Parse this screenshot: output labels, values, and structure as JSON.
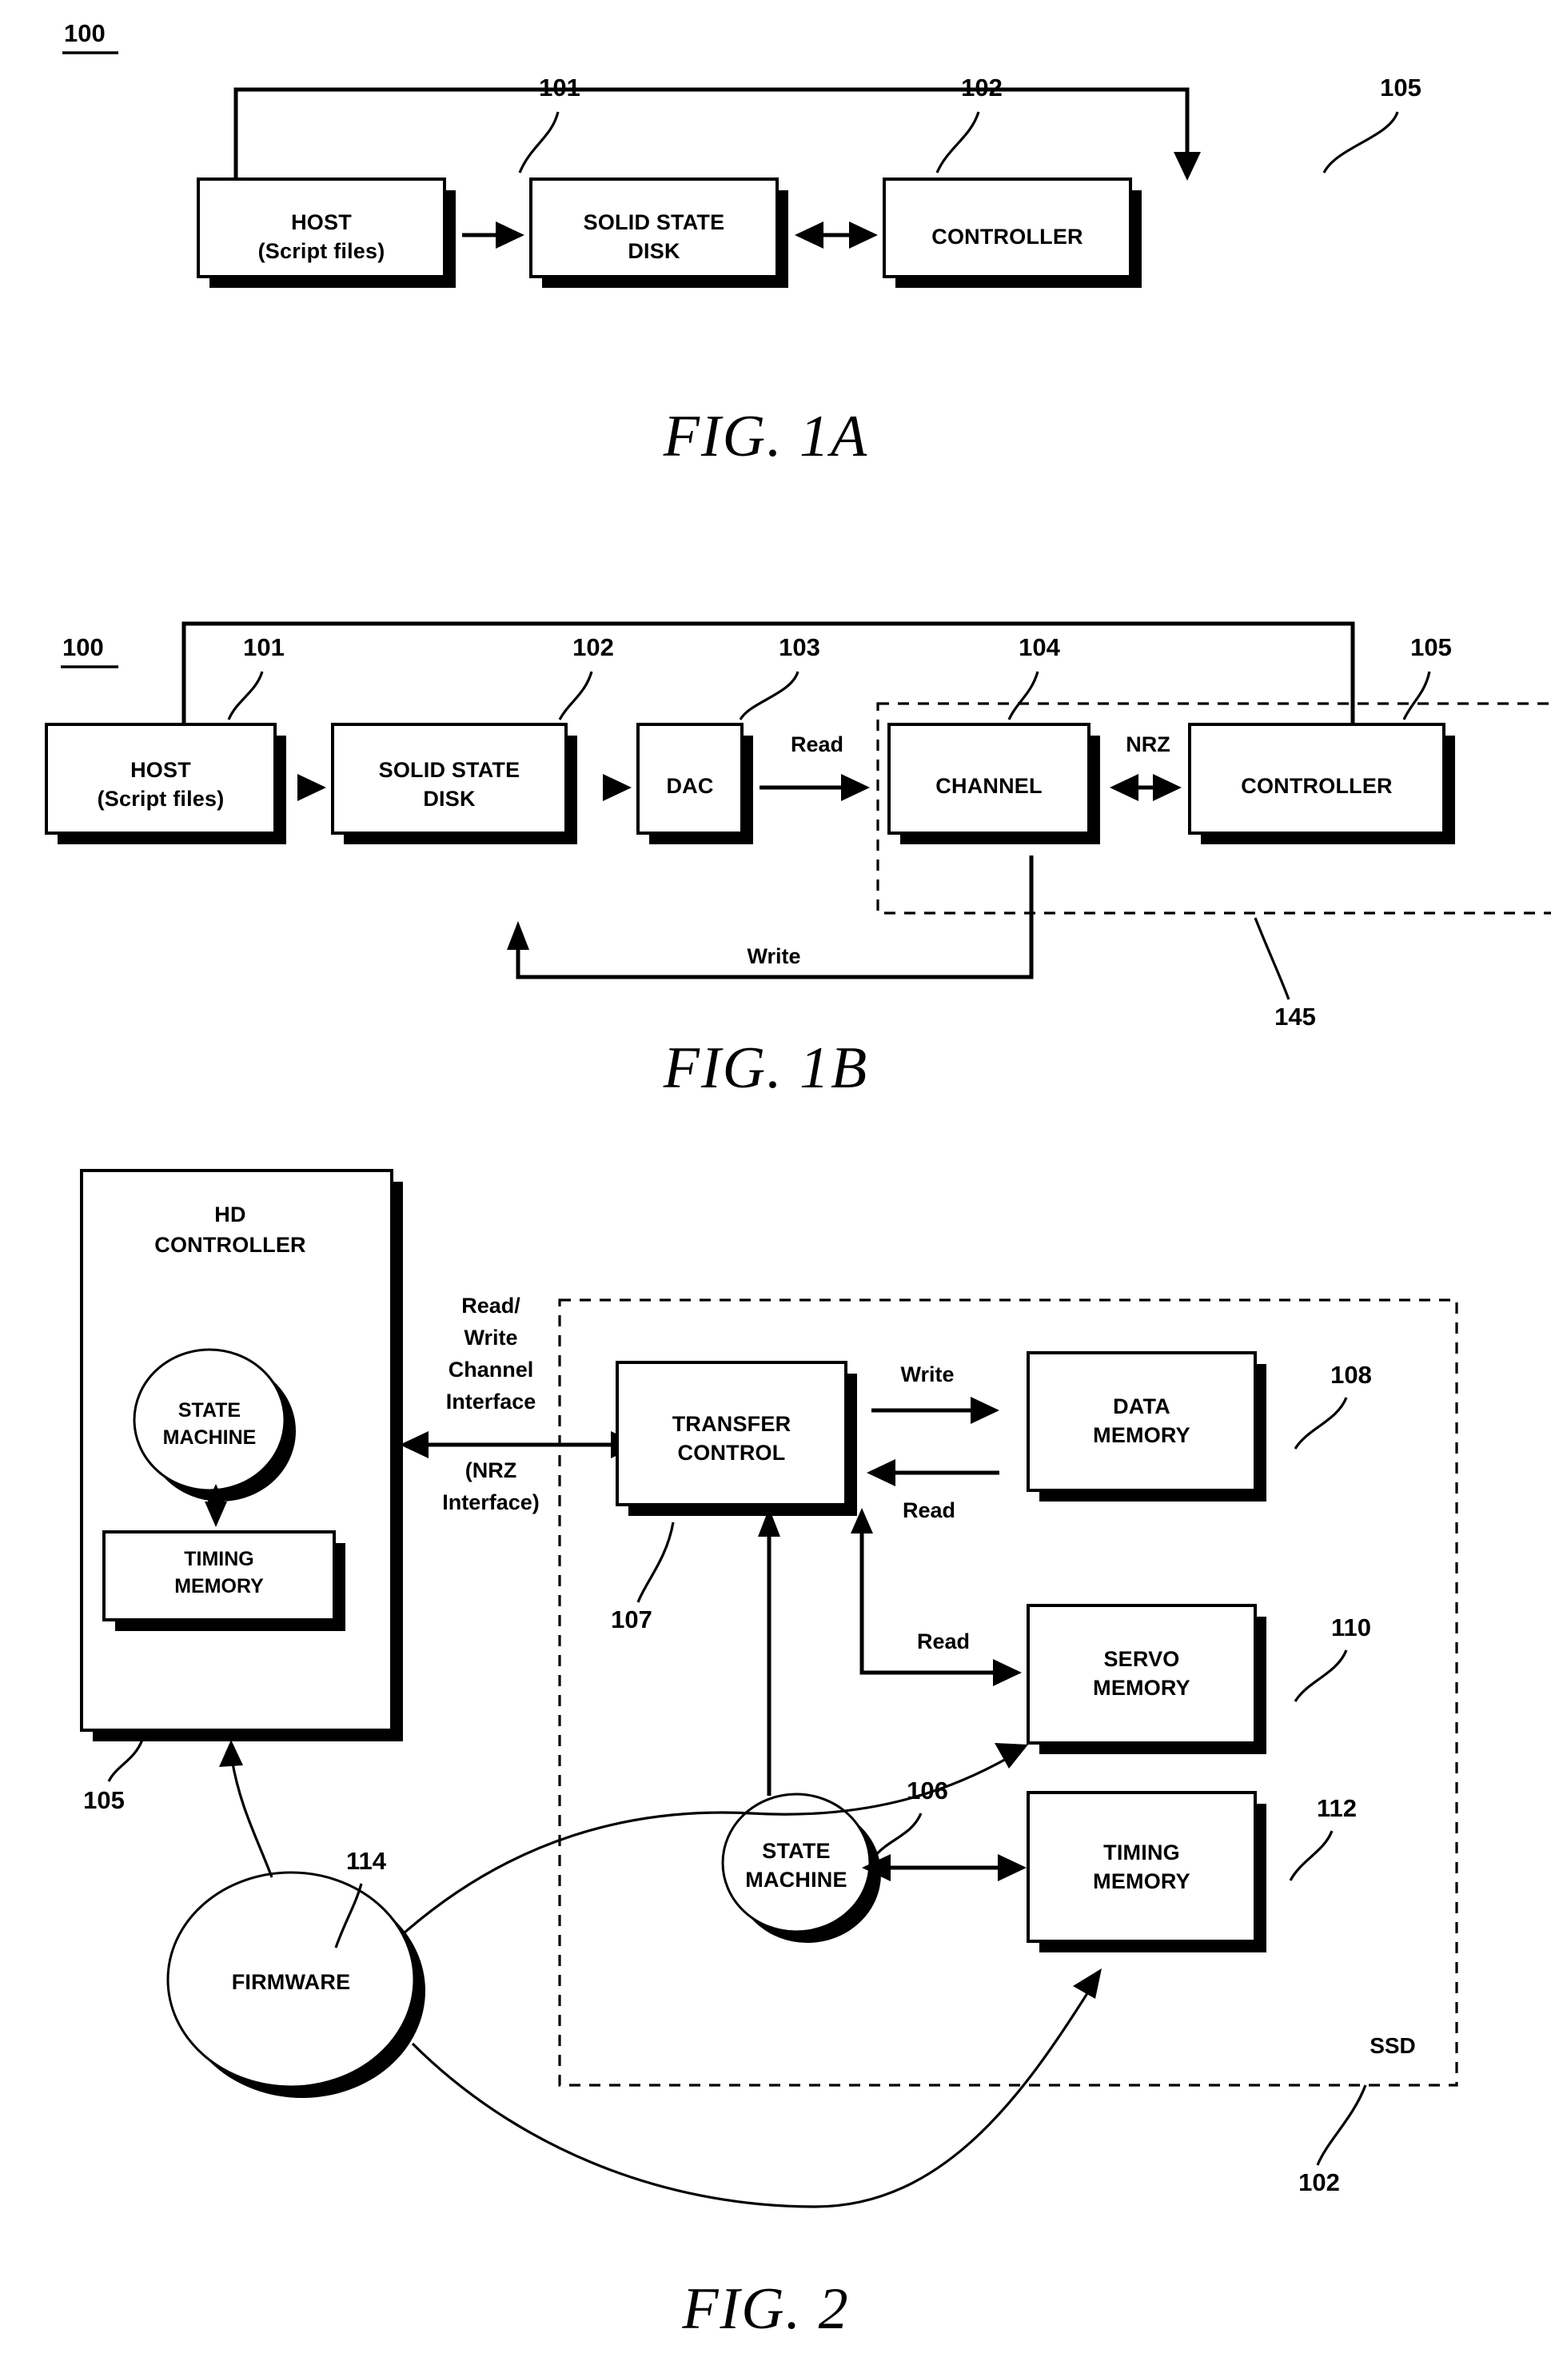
{
  "document": {
    "type": "patent-figure-sheet",
    "figures": [
      "FIG. 1A",
      "FIG. 1B",
      "FIG. 2"
    ]
  },
  "fig1a": {
    "title": "FIG. 1A",
    "system_ref": "100",
    "boxes": [
      {
        "id": "host",
        "line1": "HOST",
        "line2": "(Script files)",
        "ref": "101"
      },
      {
        "id": "ssd",
        "line1": "SOLID STATE",
        "line2": "DISK",
        "ref": "102"
      },
      {
        "id": "controller",
        "line1": "CONTROLLER",
        "line2": "",
        "ref": "105"
      }
    ]
  },
  "fig1b": {
    "title": "FIG. 1B",
    "system_ref": "100",
    "boxes": [
      {
        "id": "host",
        "line1": "HOST",
        "line2": "(Script files)",
        "ref": "101"
      },
      {
        "id": "ssd",
        "line1": "SOLID STATE",
        "line2": "DISK",
        "ref": "102"
      },
      {
        "id": "dac",
        "line1": "DAC",
        "line2": "",
        "ref": "103"
      },
      {
        "id": "channel",
        "line1": "CHANNEL",
        "line2": "",
        "ref": "104"
      },
      {
        "id": "controller",
        "line1": "CONTROLLER",
        "line2": "",
        "ref": "105"
      }
    ],
    "edge_labels": {
      "read": "Read",
      "nrz": "NRZ",
      "write": "Write"
    },
    "group_ref": "145"
  },
  "fig2": {
    "title": "FIG. 2",
    "hd_controller": {
      "line1": "HD",
      "line2": "CONTROLLER",
      "ref": "105",
      "state_machine": {
        "line1": "STATE",
        "line2": "MACHINE"
      },
      "timing_memory": {
        "line1": "TIMING",
        "line2": "MEMORY"
      }
    },
    "interface_label": {
      "line1": "Read/",
      "line2": "Write",
      "line3": "Channel",
      "line4": "Interface",
      "line5": "(NRZ",
      "line6": "Interface)"
    },
    "ssd": {
      "label": "SSD",
      "ref": "102",
      "transfer_control": {
        "line1": "TRANSFER",
        "line2": "CONTROL",
        "ref": "107"
      },
      "data_memory": {
        "line1": "DATA",
        "line2": "MEMORY",
        "ref": "108"
      },
      "servo_memory": {
        "line1": "SERVO",
        "line2": "MEMORY",
        "ref": "110"
      },
      "timing_memory": {
        "line1": "TIMING",
        "line2": "MEMORY",
        "ref": "112"
      },
      "state_machine": {
        "line1": "STATE",
        "line2": "MACHINE",
        "ref": "106"
      },
      "edge_labels": {
        "write": "Write",
        "read_data": "Read",
        "read_servo": "Read"
      }
    },
    "firmware": {
      "label": "FIRMWARE",
      "ref": "114"
    }
  },
  "colors": {
    "ink": "#000000",
    "paper": "#ffffff"
  }
}
